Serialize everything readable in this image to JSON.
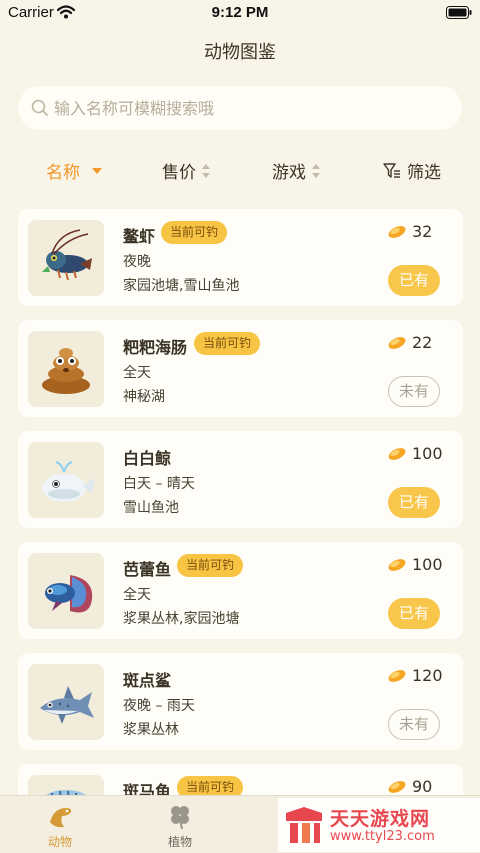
{
  "status": {
    "carrier": "Carrier",
    "time": "9:12 PM"
  },
  "header": {
    "title": "动物图鉴"
  },
  "search": {
    "placeholder": "输入名称可模糊搜索哦"
  },
  "sort_tabs": {
    "name": "名称",
    "price": "售价",
    "game": "游戏",
    "filter": "筛选"
  },
  "fish_list": [
    {
      "name": "鳌虾",
      "badge": "当前可钓",
      "time": "夜晚",
      "location": "家园池塘,雪山鱼池",
      "price": "32",
      "status": "已有",
      "owned": true,
      "icon": "crayfish-icon"
    },
    {
      "name": "粑粑海肠",
      "badge": "当前可钓",
      "time": "全天",
      "location": "神秘湖",
      "price": "22",
      "status": "未有",
      "owned": false,
      "icon": "poop-worm-icon"
    },
    {
      "name": "白白鲸",
      "badge": "",
      "time": "白天 – 晴天",
      "location": "雪山鱼池",
      "price": "100",
      "status": "已有",
      "owned": true,
      "icon": "whale-icon"
    },
    {
      "name": "芭蕾鱼",
      "badge": "当前可钓",
      "time": "全天",
      "location": "浆果丛林,家园池塘",
      "price": "100",
      "status": "已有",
      "owned": true,
      "icon": "betta-fish-icon"
    },
    {
      "name": "斑点鲨",
      "badge": "",
      "time": "夜晚 – 雨天",
      "location": "浆果丛林",
      "price": "120",
      "status": "未有",
      "owned": false,
      "icon": "shark-icon"
    },
    {
      "name": "斑马鱼",
      "badge": "当前可钓",
      "price": "90"
    }
  ],
  "tab_bar": {
    "animals": "动物",
    "plants": "植物"
  },
  "watermark": {
    "brand": "天天游戏网",
    "url": "www.ttyl23.com"
  },
  "colors": {
    "accent": "#f0982a",
    "badge": "#f7c443",
    "owned_button": "#f8c64a",
    "background": "#f8f4e8"
  }
}
